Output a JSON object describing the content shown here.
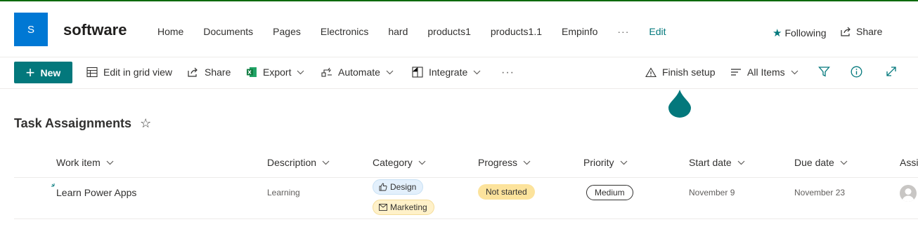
{
  "site": {
    "logo_letter": "S",
    "title": "software",
    "nav": [
      "Home",
      "Documents",
      "Pages",
      "Electronics",
      "hard",
      "products1",
      "products1.1",
      "Empinfo"
    ],
    "nav_more": "···",
    "nav_edit": "Edit",
    "following_label": "Following",
    "share_label": "Share"
  },
  "commandbar": {
    "new_label": "New",
    "edit_grid_label": "Edit in grid view",
    "share_label": "Share",
    "export_label": "Export",
    "automate_label": "Automate",
    "integrate_label": "Integrate",
    "more_label": "···",
    "finish_setup_label": "Finish setup",
    "view_label": "All Items"
  },
  "list": {
    "title": "Task Assaignments",
    "favorite_icon": "☆",
    "columns": [
      "Work item",
      "Description",
      "Category",
      "Progress",
      "Priority",
      "Start date",
      "Due date",
      "Assi"
    ],
    "rows": [
      {
        "work_item": "Learn Power Apps",
        "description": "Learning",
        "categories": [
          "Design",
          "Marketing"
        ],
        "progress": "Not started",
        "priority": "Medium",
        "start_date": "November 9",
        "due_date": "November 23"
      }
    ]
  },
  "colors": {
    "accent": "#03787c",
    "brand_logo": "#0078d4",
    "status_not_started": "#fce39c",
    "design_pill": "#e3f0fc",
    "marketing_pill": "#fff1c9"
  }
}
